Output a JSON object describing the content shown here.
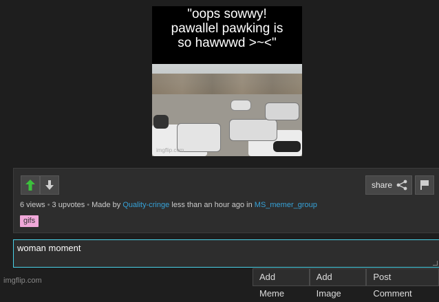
{
  "meme": {
    "caption": "\"oops sowwy!\npawallel pawking is\nso hawwwd >~<\"",
    "watermark": "imgflip.com"
  },
  "post": {
    "views": "6 views",
    "upvotes": "3 upvotes",
    "made_by_prefix": "Made by",
    "author": "Quality-cringe",
    "time": "less than an hour ago in",
    "group": "MS_memer_group",
    "tag": "gifs"
  },
  "buttons": {
    "share_label": "share",
    "upvote_icon": "up-arrow-icon",
    "downvote_icon": "down-arrow-icon",
    "flag_icon": "flag-icon",
    "share_icon": "share-icon"
  },
  "comment": {
    "value": "woman moment"
  },
  "actions": {
    "add_meme": "Add Meme",
    "add_image": "Add Image",
    "post_comment": "Post Comment"
  },
  "footer": {
    "watermark": "imgflip.com"
  },
  "colors": {
    "accent": "#36a2d8",
    "focus_border": "#4ad4ea",
    "upvote_green": "#3cc13c",
    "tag_pink": "#f0a8d9"
  }
}
